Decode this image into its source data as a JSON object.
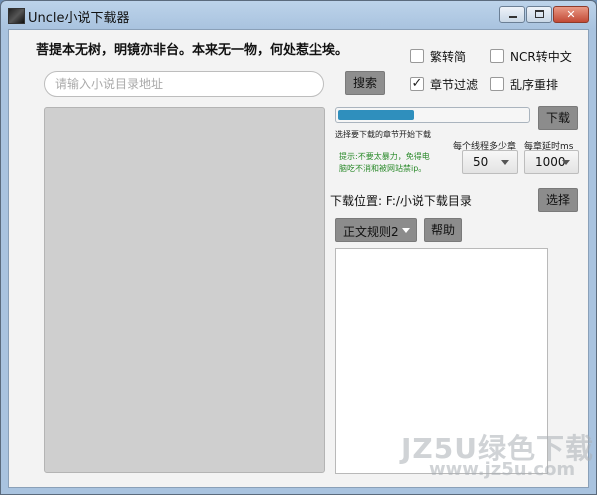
{
  "window": {
    "title": "Uncle小说下载器"
  },
  "motto": "菩提本无树，明镜亦非台。本来无一物，何处惹尘埃。",
  "search": {
    "placeholder": "请输入小说目录地址",
    "button_label": "搜索"
  },
  "options": {
    "traditional_to_simplified": {
      "label": "繁转简",
      "checked": false
    },
    "ncr_to_chinese": {
      "label": "NCR转中文",
      "checked": false
    },
    "chapter_filter": {
      "label": "章节过滤",
      "checked": true
    },
    "shuffle_reorder": {
      "label": "乱序重排",
      "checked": false
    }
  },
  "download": {
    "button_label": "下载",
    "progress_percent": 40,
    "hint": "选择要下载的章节开始下载",
    "threads_label": "每个线程多少章",
    "delay_label": "每章延时ms",
    "threads_value": "50",
    "delay_value": "1000",
    "tip_line1": "提示:不要太暴力，免得电",
    "tip_line2": "脑吃不消和被网站禁ip。",
    "location_label": "下载位置: F:/小说下载目录",
    "select_label": "选择"
  },
  "rules": {
    "selected": "正文规则2",
    "help_label": "帮助"
  },
  "watermark": {
    "line1": "JZ5U绿色下载",
    "line2": "www.jz5u.com"
  },
  "colors": {
    "progress": "#2f8fbd",
    "tip": "#2a8a2a",
    "list_bg": "#cfcfcf"
  }
}
